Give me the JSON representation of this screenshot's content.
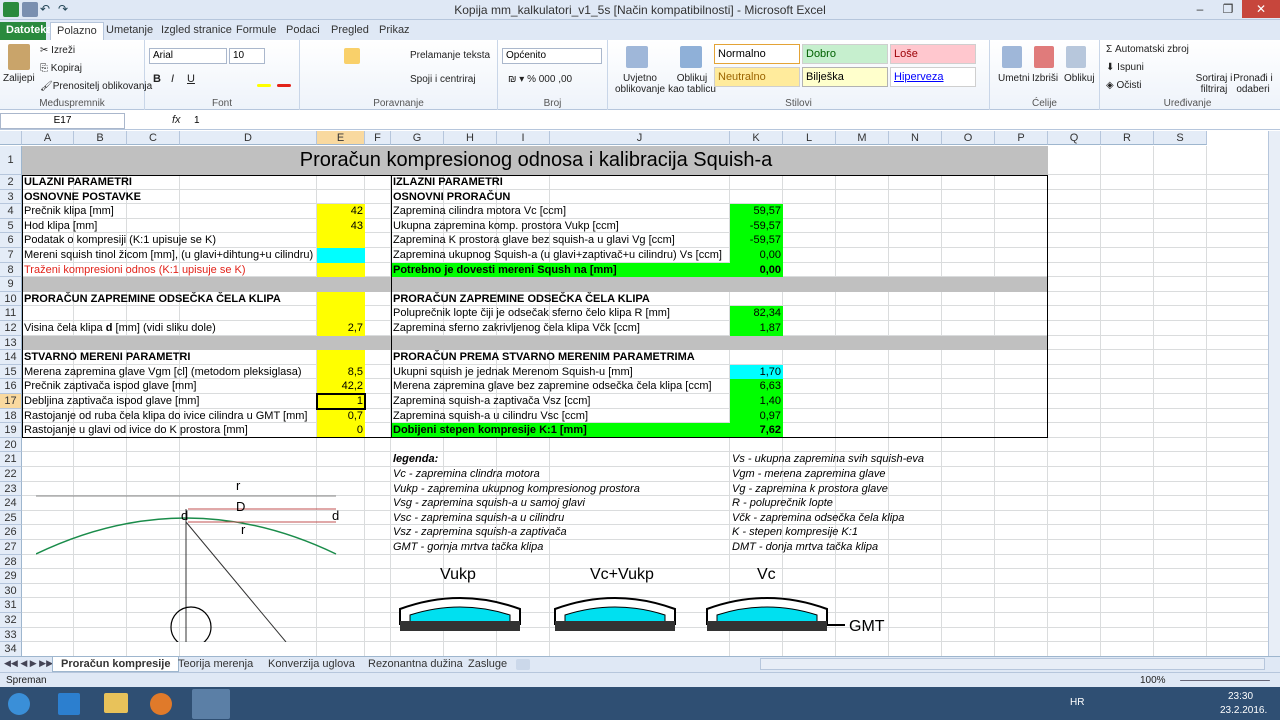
{
  "window": {
    "title": "Kopija mm_kalkulatori_v1_5s  [Način kompatibilnosti]  -  Microsoft Excel"
  },
  "tabs": [
    "Datoteka",
    "Polazno",
    "Umetanje",
    "Izgled stranice",
    "Formule",
    "Podaci",
    "Pregled",
    "Prikaz"
  ],
  "ribbon": {
    "clipboard": {
      "paste": "Zalijepi",
      "cut": "Izreži",
      "copy": "Kopiraj",
      "painter": "Prenositelj oblikovanja",
      "label": "Međuspremnik"
    },
    "font": {
      "name": "Arial",
      "size": "10",
      "label": "Font"
    },
    "alignment": {
      "wrap": "Prelamanje teksta",
      "merge": "Spoji i centriraj",
      "label": "Poravnanje"
    },
    "number": {
      "format": "Općenito",
      "label": "Broj"
    },
    "styles": {
      "conditional": "Uvjetno oblikovanje",
      "table": "Oblikuj kao tablicu",
      "normal": "Normalno",
      "good": "Dobro",
      "bad": "Loše",
      "neutral": "Neutralno",
      "note": "Bilješka",
      "hyperlink": "Hiperveza",
      "label": "Stilovi"
    },
    "cells": {
      "insert": "Umetni",
      "delete": "Izbriši",
      "format": "Oblikuj",
      "label": "Ćelije"
    },
    "editing": {
      "autosum": "Automatski zbroj",
      "fill": "Ispuni",
      "clear": "Očisti",
      "sort": "Sortiraj i filtriraj",
      "find": "Pronađi i odaberi",
      "label": "Uređivanje"
    }
  },
  "formula_bar": {
    "name_box": "E17",
    "fx": "fx",
    "value": "1"
  },
  "columns": [
    "A",
    "B",
    "C",
    "D",
    "E",
    "F",
    "G",
    "H",
    "I",
    "J",
    "K",
    "L",
    "M",
    "N",
    "O",
    "P",
    "Q",
    "R",
    "S"
  ],
  "rows": [
    "1",
    "2",
    "3",
    "4",
    "5",
    "6",
    "7",
    "8",
    "9",
    "10",
    "11",
    "12",
    "13",
    "14",
    "15",
    "16",
    "17",
    "18",
    "19",
    "20",
    "21",
    "22",
    "23",
    "24",
    "25",
    "26",
    "27",
    "28",
    "29",
    "30",
    "31",
    "32",
    "33",
    "34"
  ],
  "sheet": {
    "title": "Proračun kompresionog odnosa i kalibracija Squish-a",
    "in_header": "ULAZNI PARAMETRI",
    "out_header": "IZLAZNI PARAMETRI",
    "basic": "OSNOVNE POSTAVKE",
    "basic_calc": "OSNOVNI PRORAČUN",
    "in": [
      {
        "label": "Prečnik klipa [mm]",
        "value": "42"
      },
      {
        "label": "Hod klipa [mm]",
        "value": "43"
      },
      {
        "label": "Podatak o kompresiji (K:1 upisuje se K)",
        "value": ""
      },
      {
        "label": "Mereni squish tinol žicom [mm], (u glavi+dihtung+u cilindru)",
        "value": ""
      },
      {
        "label": "Traženi kompresioni odnos (K:1 upisuje se K)",
        "value": ""
      }
    ],
    "out": [
      {
        "label": "Zapremina cilindra motora Vc [ccm]",
        "value": "59,57"
      },
      {
        "label": "Ukupna zapremina komp. prostora Vukp [ccm]",
        "value": "-59,57"
      },
      {
        "label": "Zapremina K prostora glave bez squish-a u glavi Vg [ccm]",
        "value": "-59,57"
      },
      {
        "label": "Zapremina ukupnog Squish-a (u glavi+zaptivač+u cilindru) Vs [ccm]",
        "value": "0,00"
      },
      {
        "label": "Potrebno je dovesti mereni Sqush na [mm]",
        "value": "0,00"
      }
    ],
    "sec2_in": "PRORAČUN ZAPREMINE ODSEČKA ČELA KLIPA",
    "sec2_out": "PRORAČUN ZAPREMINE ODSEČKA ČELA KLIPA",
    "r_label": "Poluprečnik lopte čiji je odsečak sferno čelo klipa R [mm]",
    "r_value": "82,34",
    "h_label": "Visina čela klipa ",
    "h_bold": "d",
    "h_tail": " [mm] (vidi sliku dole)",
    "h_value": "2,7",
    "vck_label": "Zapremina sferno zakrivljenog čela klipa Včk [ccm]",
    "vck_value": "1,87",
    "sec3_in": "STVARNO MERENI PARAMETRI",
    "sec3_out": "PRORAČUN PREMA STVARNO MERENIM PARAMETRIMA",
    "meas": [
      {
        "label": "Merena zapremina glave Vgm [cl] (metodom pleksiglasa)",
        "value": "8,5"
      },
      {
        "label": "Prečnik zaptivača ispod glave [mm]",
        "value": "42,2"
      },
      {
        "label": "Debljina zaptivača ispod glave [mm]",
        "value": "1"
      },
      {
        "label": "Rastojanje od ruba čela klipa do ivice cilindra u GMT [mm]",
        "value": "0,7"
      },
      {
        "label": "Rastojanje u glavi od ivice do K prostora [mm]",
        "value": "0"
      }
    ],
    "calc": [
      {
        "label": "Ukupni squish je jednak Merenom Squish-u [mm]",
        "value": "1,70"
      },
      {
        "label": "Merena zapremina glave bez zapremine odsečka čela klipa [ccm]",
        "value": "6,63"
      },
      {
        "label": "Zapremina squish-a zaptivača Vsz [ccm]",
        "value": "1,40"
      },
      {
        "label": "Zapremina squish-a u cilindru Vsc [ccm]",
        "value": "0,97"
      },
      {
        "label": "Dobijeni stepen kompresije K:1 [mm]",
        "value": "7,62"
      }
    ],
    "legend_title": "legenda:",
    "legend_left": [
      "Vc - zapremina clindra motora",
      "Vukp - zapremina ukupnog kompresionog prostora",
      "Vsg - zapremina squish-a u samoj glavi",
      "Vsc - zapremina squish-a u cilindru",
      "Vsz - zapremina squish-a zaptivača",
      "GMT - gornja mrtva tačka klipa"
    ],
    "legend_right": [
      "Vs - ukupna zapremina svih squish-eva",
      "Vgm - merena zapremina glave",
      "Vg - zapremina k prostora glave",
      "R - poluprečnik lopte",
      "Včk - zapremina odsečka čela klipa",
      "K - stepen kompresije K:1",
      "DMT - donja mrtva tačka klipa"
    ],
    "diagram": {
      "r_top": "r",
      "D": "D",
      "d_left": "d",
      "d_right": "d",
      "r_mid": "r"
    },
    "pics": {
      "vukp": "Vukp",
      "vcvukp": "Vc+Vukp",
      "vc": "Vc",
      "gmt": "GMT"
    }
  },
  "sheet_tabs": [
    "Proračun kompresije",
    "Teorija merenja",
    "Konverzija uglova",
    "Rezonantna dužina",
    "Zasluge"
  ],
  "status": {
    "ready": "Spreman",
    "zoom": "100%"
  },
  "taskbar": {
    "lang": "HR",
    "time": "23:30",
    "date": "23.2.2016."
  },
  "colors": {
    "yellow": "#ffff00",
    "green": "#00ff00",
    "cyan": "#00ffff",
    "gray": "#c0c0c0",
    "red_text": "#e2231a"
  }
}
